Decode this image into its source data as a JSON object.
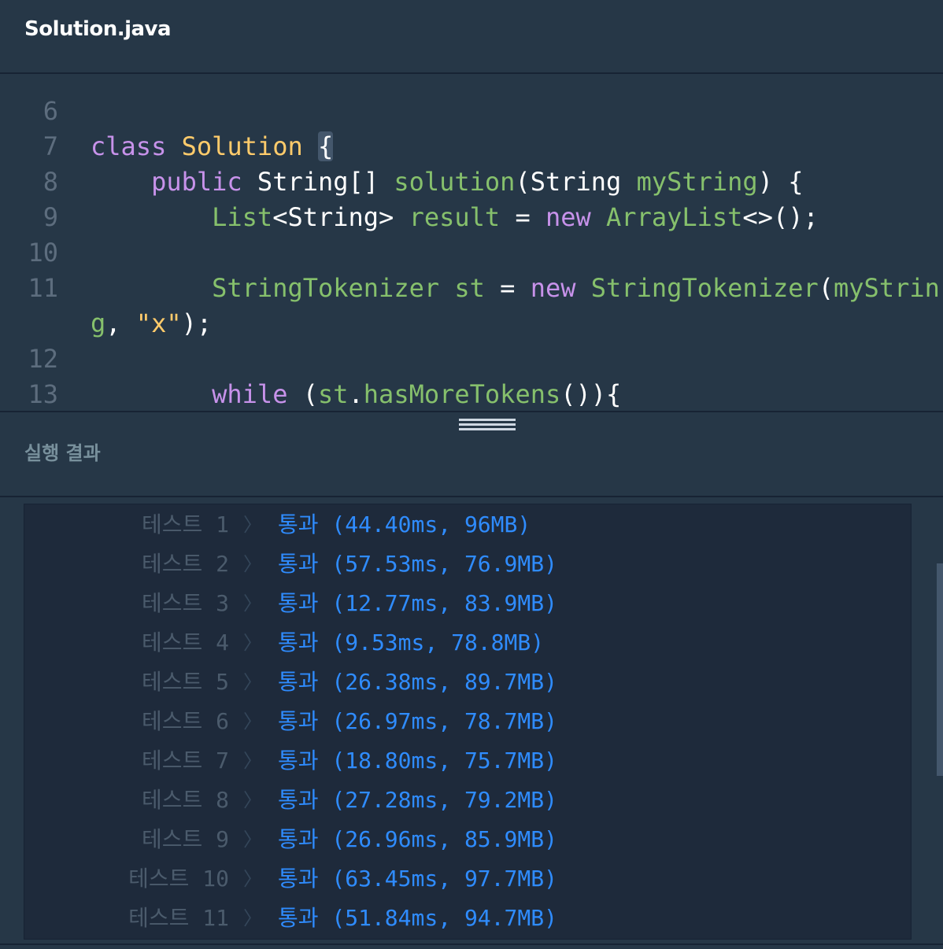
{
  "tab": {
    "filename": "Solution.java"
  },
  "editor": {
    "lines": [
      {
        "no": "6",
        "tokens": []
      },
      {
        "no": "7",
        "tokens": [
          {
            "t": "class ",
            "c": "kw"
          },
          {
            "t": "Solution ",
            "c": "cls"
          },
          {
            "t": "{",
            "c": "pl",
            "hl": true
          }
        ]
      },
      {
        "no": "8",
        "tokens": [
          {
            "t": "    ",
            "c": "pl"
          },
          {
            "t": "public ",
            "c": "kw"
          },
          {
            "t": "String[] ",
            "c": "pl"
          },
          {
            "t": "solution",
            "c": "typ"
          },
          {
            "t": "(String ",
            "c": "pl"
          },
          {
            "t": "myString",
            "c": "typ"
          },
          {
            "t": ") {",
            "c": "pl"
          }
        ]
      },
      {
        "no": "9",
        "tokens": [
          {
            "t": "        ",
            "c": "pl"
          },
          {
            "t": "List",
            "c": "typ"
          },
          {
            "t": "<String> ",
            "c": "pl"
          },
          {
            "t": "result ",
            "c": "typ"
          },
          {
            "t": "= ",
            "c": "pl"
          },
          {
            "t": "new ",
            "c": "kw"
          },
          {
            "t": "ArrayList",
            "c": "typ"
          },
          {
            "t": "<>();",
            "c": "pl"
          }
        ]
      },
      {
        "no": "10",
        "tokens": []
      },
      {
        "no": "11",
        "tokens": [
          {
            "t": "        ",
            "c": "pl"
          },
          {
            "t": "StringTokenizer ",
            "c": "typ"
          },
          {
            "t": "st ",
            "c": "typ"
          },
          {
            "t": "= ",
            "c": "pl"
          },
          {
            "t": "new ",
            "c": "kw"
          },
          {
            "t": "StringTokenizer",
            "c": "typ"
          },
          {
            "t": "(",
            "c": "pl"
          },
          {
            "t": "myStrin",
            "c": "typ"
          }
        ]
      },
      {
        "no": "",
        "tokens": [
          {
            "t": "g",
            "c": "typ"
          },
          {
            "t": ", ",
            "c": "pl"
          },
          {
            "t": "\"x\"",
            "c": "str"
          },
          {
            "t": ");",
            "c": "pl"
          }
        ]
      },
      {
        "no": "12",
        "tokens": []
      },
      {
        "no": "13",
        "tokens": [
          {
            "t": "        ",
            "c": "pl"
          },
          {
            "t": "while ",
            "c": "kw"
          },
          {
            "t": "(",
            "c": "pl"
          },
          {
            "t": "st",
            "c": "typ"
          },
          {
            "t": ".",
            "c": "pl"
          },
          {
            "t": "hasMoreTokens",
            "c": "typ"
          },
          {
            "t": "()){",
            "c": "pl"
          }
        ]
      }
    ]
  },
  "results": {
    "title": "실행 결과",
    "rows": [
      {
        "label": "테스트 1",
        "sep": "〉",
        "status": "통과 (44.40ms, 96MB)"
      },
      {
        "label": "테스트 2",
        "sep": "〉",
        "status": "통과 (57.53ms, 76.9MB)"
      },
      {
        "label": "테스트 3",
        "sep": "〉",
        "status": "통과 (12.77ms, 83.9MB)"
      },
      {
        "label": "테스트 4",
        "sep": "〉",
        "status": "통과 (9.53ms, 78.8MB)"
      },
      {
        "label": "테스트 5",
        "sep": "〉",
        "status": "통과 (26.38ms, 89.7MB)"
      },
      {
        "label": "테스트 6",
        "sep": "〉",
        "status": "통과 (26.97ms, 78.7MB)"
      },
      {
        "label": "테스트 7",
        "sep": "〉",
        "status": "통과 (18.80ms, 75.7MB)"
      },
      {
        "label": "테스트 8",
        "sep": "〉",
        "status": "통과 (27.28ms, 79.2MB)"
      },
      {
        "label": "테스트 9",
        "sep": "〉",
        "status": "통과 (26.96ms, 85.9MB)"
      },
      {
        "label": "테스트 10",
        "sep": "〉",
        "status": "통과 (63.45ms, 97.7MB)"
      },
      {
        "label": "테스트 11",
        "sep": "〉",
        "status": "통과 (51.84ms, 94.7MB)"
      }
    ]
  },
  "colors": {
    "background": "#263747",
    "results_background": "#1e2a3b",
    "keyword": "#c792ea",
    "class_name": "#ffcb6b",
    "identifier": "#86c06c",
    "pass": "#2f8cff"
  }
}
